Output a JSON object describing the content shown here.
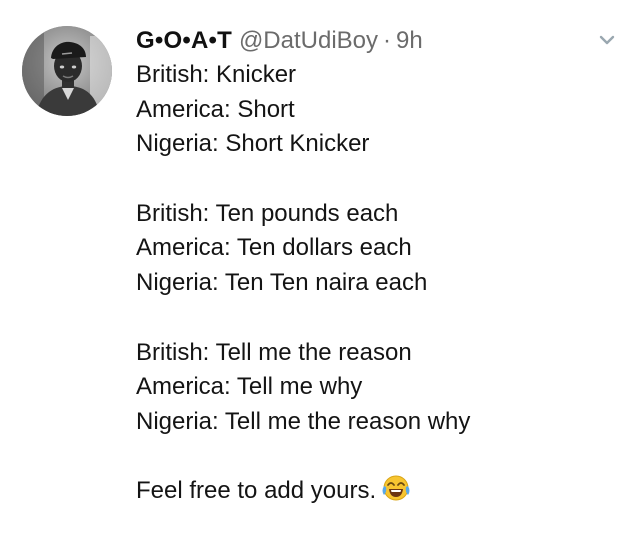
{
  "tweet": {
    "author_name": "G•O•A•T",
    "handle": "@DatUdiBoy",
    "separator": "·",
    "time": "9h",
    "lines": [
      "British: Knicker",
      "America: Short",
      "Nigeria: Short Knicker",
      "British: Ten pounds each",
      "America: Ten dollars each",
      "Nigeria: Ten Ten naira each",
      "British: Tell me the reason",
      "America: Tell me why",
      "Nigeria: Tell me the reason why"
    ],
    "closing_line": "Feel free to add yours.",
    "closing_emoji": "face-with-tears-of-joy-icon"
  },
  "colors": {
    "text": "#141414",
    "secondary": "#6b6b6b",
    "chevron": "#9aa7b0"
  }
}
